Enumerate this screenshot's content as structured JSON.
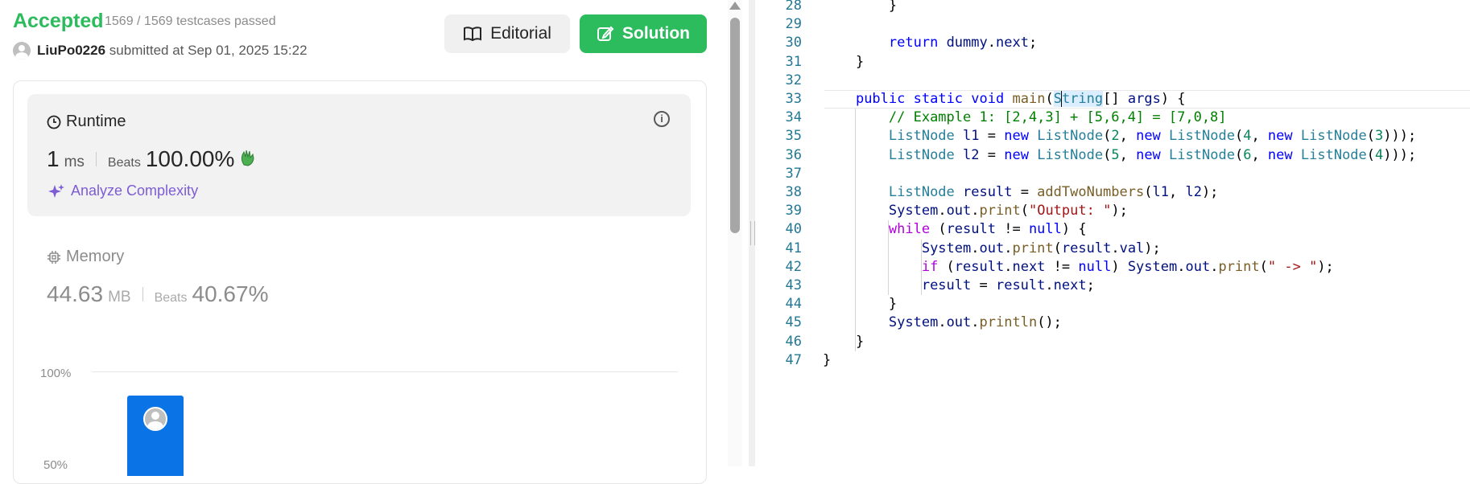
{
  "submission": {
    "status": "Accepted",
    "testcases": "1569 / 1569 testcases passed",
    "user": "LiuPo0226",
    "submitted_text": "submitted at Sep 01, 2025 15:22"
  },
  "buttons": {
    "editorial": "Editorial",
    "solution": "Solution"
  },
  "runtime": {
    "title": "Runtime",
    "value": "1",
    "unit": "ms",
    "beats_label": "Beats",
    "beats_value": "100.00%",
    "analyze": "Analyze Complexity"
  },
  "memory": {
    "title": "Memory",
    "value": "44.63",
    "unit": "MB",
    "beats_label": "Beats",
    "beats_value": "40.67%"
  },
  "chart": {
    "axis_100": "100%",
    "axis_50": "50%"
  },
  "colors": {
    "accepted": "#2cbb5d",
    "bar": "#0a74e6",
    "analyze": "#7d5cd6"
  },
  "code_lines": [
    {
      "n": "28",
      "t": "        }"
    },
    {
      "n": "29",
      "t": ""
    },
    {
      "n": "30",
      "t": "        return dummy.next;"
    },
    {
      "n": "31",
      "t": "    }"
    },
    {
      "n": "32",
      "t": ""
    },
    {
      "n": "33",
      "t": "    public static void main(String[] args) {"
    },
    {
      "n": "34",
      "t": "        // Example 1: [2,4,3] + [5,6,4] = [7,0,8]"
    },
    {
      "n": "35",
      "t": "        ListNode l1 = new ListNode(2, new ListNode(4, new ListNode(3)));"
    },
    {
      "n": "36",
      "t": "        ListNode l2 = new ListNode(5, new ListNode(6, new ListNode(4)));"
    },
    {
      "n": "37",
      "t": ""
    },
    {
      "n": "38",
      "t": "        ListNode result = addTwoNumbers(l1, l2);"
    },
    {
      "n": "39",
      "t": "        System.out.print(\"Output: \");"
    },
    {
      "n": "40",
      "t": "        while (result != null) {"
    },
    {
      "n": "41",
      "t": "            System.out.print(result.val);"
    },
    {
      "n": "42",
      "t": "            if (result.next != null) System.out.print(\" -> \");"
    },
    {
      "n": "43",
      "t": "            result = result.next;"
    },
    {
      "n": "44",
      "t": "        }"
    },
    {
      "n": "45",
      "t": "        System.out.println();"
    },
    {
      "n": "46",
      "t": "    }"
    },
    {
      "n": "47",
      "t": "}"
    }
  ]
}
